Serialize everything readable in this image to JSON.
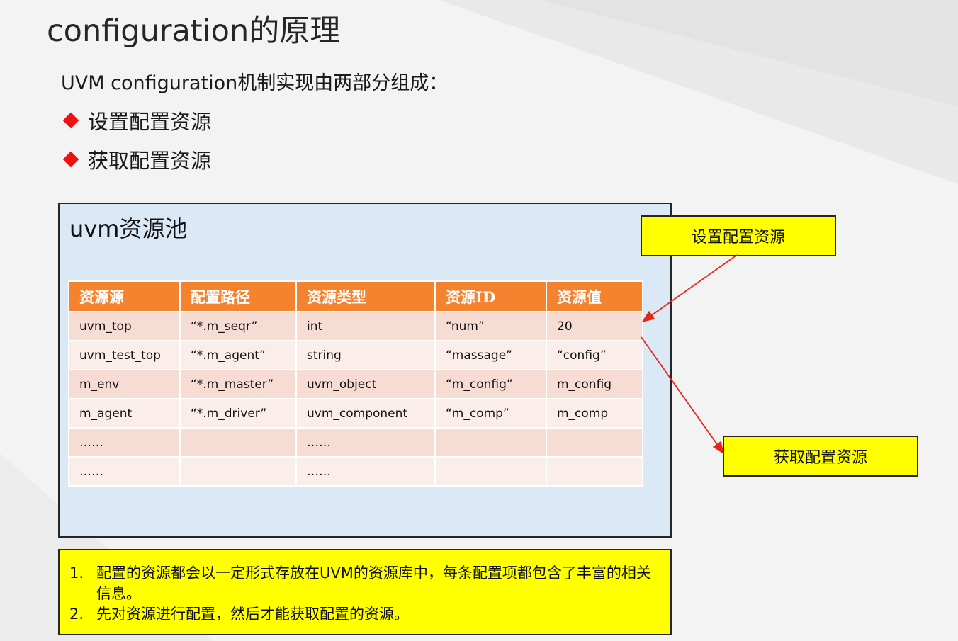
{
  "slide": {
    "title": "configuration的原理",
    "intro": "UVM configuration机制实现由两部分组成：",
    "bullets": [
      {
        "icon": "red-diamond-icon",
        "text": "设置配置资源"
      },
      {
        "icon": "red-diamond-icon",
        "text": "获取配置资源"
      }
    ]
  },
  "pool": {
    "title": "uvm资源池",
    "table": {
      "headers": [
        "资源源",
        "配置路径",
        "资源类型",
        "资源ID",
        "资源值"
      ],
      "rows": [
        [
          "uvm_top",
          "“*.m_seqr”",
          "int",
          "“num”",
          "20"
        ],
        [
          "uvm_test_top",
          "“*.m_agent”",
          "string",
          "“massage”",
          "“config”"
        ],
        [
          "m_env",
          "“*.m_master”",
          "uvm_object",
          "“m_config”",
          "m_config"
        ],
        [
          "m_agent",
          "“*.m_driver”",
          "uvm_component",
          "“m_comp”",
          "m_comp"
        ],
        [
          "……",
          "",
          "……",
          "",
          ""
        ],
        [
          "……",
          "",
          "……",
          "",
          ""
        ]
      ]
    }
  },
  "callouts": {
    "set": "设置配置资源",
    "get": "获取配置资源"
  },
  "notes": [
    {
      "num": "1.",
      "text": "配置的资源都会以一定形式存放在UVM的资源库中，每条配置项都包含了丰富的相关信息。"
    },
    {
      "num": "2.",
      "text": "先对资源进行配置，然后才能获取配置的资源。"
    }
  ],
  "colors": {
    "background": "#f3f3f3",
    "pool_fill": "#dbe9f7",
    "table_header": "#f5822f",
    "row_odd": "#f7dcd4",
    "row_even": "#fbeeea",
    "callout_fill": "#ffff00",
    "arrow": "#e8251b",
    "bullet_diamond": "#ee1111"
  }
}
